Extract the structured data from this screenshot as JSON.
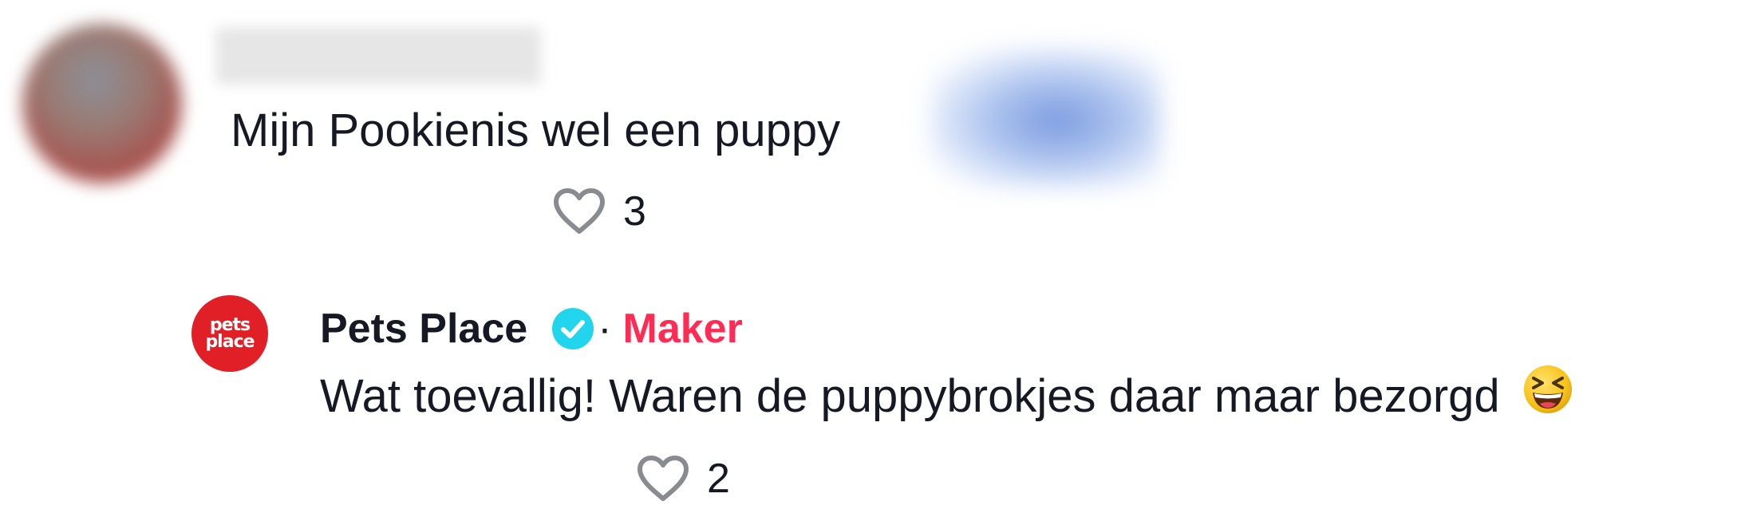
{
  "comments": [
    {
      "text": "Mijn Pookienis wel een puppy",
      "likes": "3"
    }
  ],
  "reply": {
    "author": "Pets Place",
    "avatar_text_line1": "pets",
    "avatar_text_line2": "place",
    "separator": "·",
    "badge": "Maker",
    "text": "Wat toevallig! Waren de puppybrokjes daar maar bezorgd",
    "emoji": "laughing-squint-emoji",
    "likes": "2"
  },
  "colors": {
    "text": "#161823",
    "maker": "#fe2c55",
    "verified": "#20d5ec",
    "brand_red": "#e11f26",
    "like_icon": "#8a8b91"
  },
  "icons": [
    "heart-outline-icon",
    "verified-check-icon"
  ]
}
